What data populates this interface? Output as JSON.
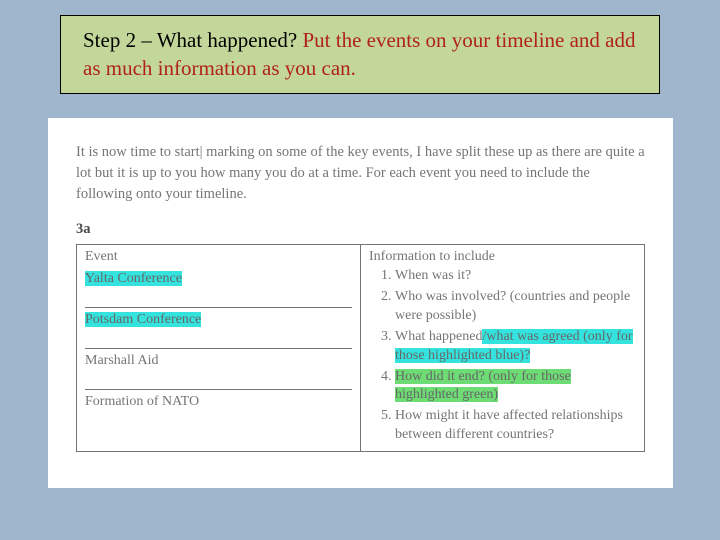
{
  "title": {
    "line1": "Step 2 – What happened? ",
    "accent": "Put the events on your timeline and add as much information as you can."
  },
  "intro": "It is now time to start| marking on some of the key events, I have split these up as there are quite a lot but it is up to you how many you do at a time. For each event you need to include the following onto your timeline.",
  "section_label": "3a",
  "table": {
    "head_event": "Event",
    "head_info": "Information to include",
    "events": {
      "e1": "Yalta Conference",
      "e2": "Potsdam Conference",
      "e3": "Marshall Aid",
      "e4": "Formation of NATO"
    },
    "info": {
      "q1": "When was it?",
      "q2": "Who was involved? (countries and people were possible)",
      "q3a": "What happened",
      "q3b": "/what was agreed (only for those highlighted blue)?",
      "q4": "How did it end? (only for those highlighted green)",
      "q5": "How might it have affected relationships between different countries?"
    }
  }
}
